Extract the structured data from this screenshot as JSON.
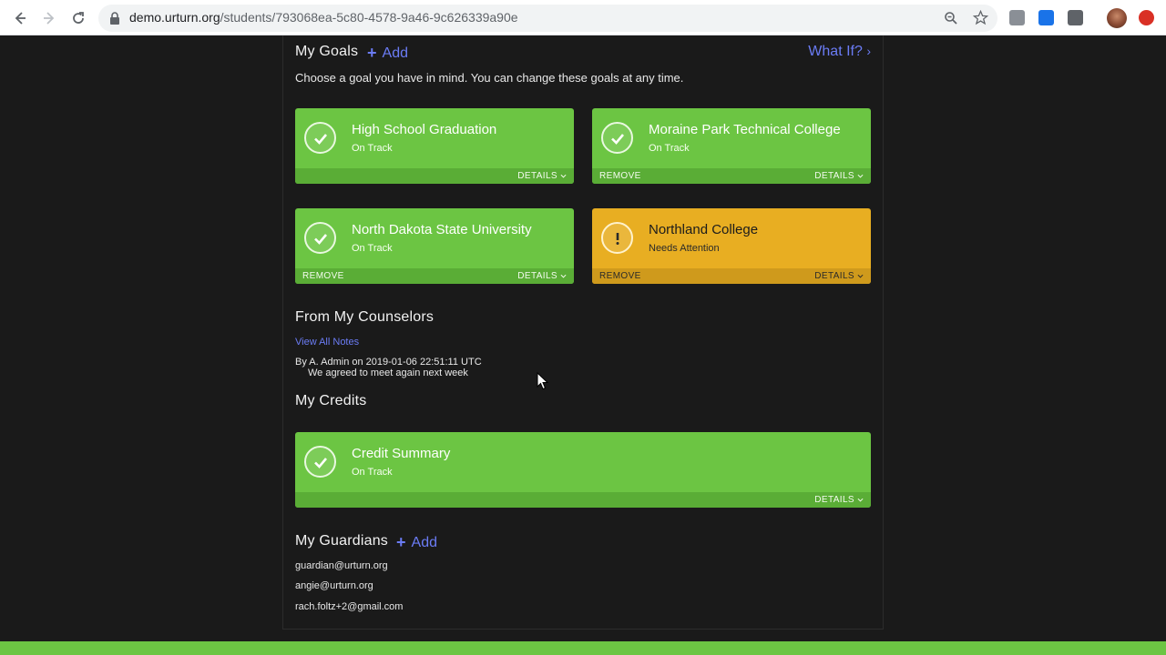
{
  "browser": {
    "url_host": "demo.urturn.org",
    "url_path": "/students/793068ea-5c80-4578-9a46-9c626339a90e"
  },
  "goals": {
    "title": "My Goals",
    "add_label": "Add",
    "what_if_label": "What If?",
    "intro": "Choose a goal you have in mind. You can change these goals at any time.",
    "cards": [
      {
        "title": "High School Graduation",
        "status": "On Track",
        "remove": "",
        "details": "DETAILS"
      },
      {
        "title": "Moraine Park Technical College",
        "status": "On Track",
        "remove": "REMOVE",
        "details": "DETAILS"
      },
      {
        "title": "North Dakota State University",
        "status": "On Track",
        "remove": "REMOVE",
        "details": "DETAILS"
      },
      {
        "title": "Northland College",
        "status": "Needs Attention",
        "remove": "REMOVE",
        "details": "DETAILS"
      }
    ]
  },
  "counselors": {
    "title": "From My Counselors",
    "view_all": "View All Notes",
    "note_meta": "By A. Admin on 2019-01-06 22:51:11 UTC",
    "note_body": "We agreed to meet again next week"
  },
  "credits": {
    "title": "My Credits",
    "card": {
      "title": "Credit Summary",
      "status": "On Track",
      "details": "DETAILS"
    }
  },
  "guardians": {
    "title": "My Guardians",
    "add_label": "Add",
    "list": [
      "guardian@urturn.org",
      "angie@urturn.org",
      "rach.foltz+2@gmail.com"
    ]
  },
  "colors": {
    "on_track": "#6cc543",
    "needs_attention": "#e8ae22",
    "link": "#6b7cf5",
    "background": "#1a1a1a"
  }
}
